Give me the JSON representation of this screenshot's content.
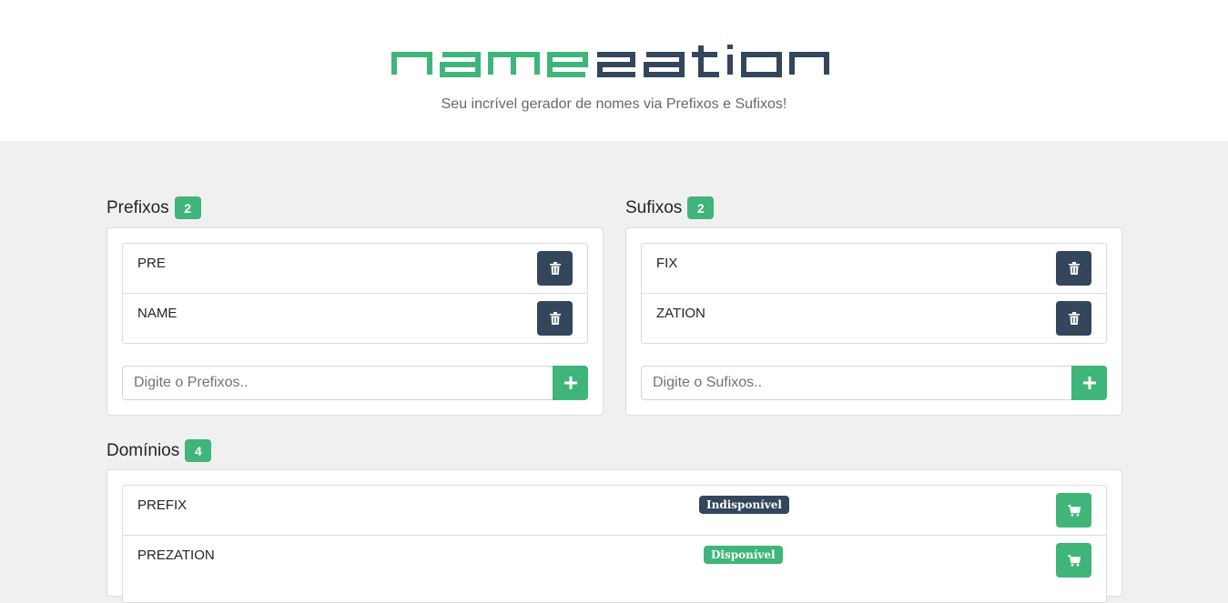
{
  "brand": {
    "logo_text": "namezation",
    "logo_part1": "name",
    "logo_part2": "zation",
    "primary_color": "#3fb57a",
    "dark_color": "#34465c",
    "tagline": "Seu incrível gerador de nomes via Prefixos e Sufixos!"
  },
  "prefixos": {
    "title": "Prefixos",
    "count": "2",
    "items": [
      {
        "label": "PRE",
        "icon": "trash-icon"
      },
      {
        "label": "NAME",
        "icon": "trash-icon"
      }
    ],
    "input_placeholder": "Digite o Prefixos..",
    "add_icon": "plus-icon"
  },
  "sufixos": {
    "title": "Sufixos",
    "count": "2",
    "items": [
      {
        "label": "FIX",
        "icon": "trash-icon"
      },
      {
        "label": "ZATION",
        "icon": "trash-icon"
      }
    ],
    "input_placeholder": "Digite o Sufixos..",
    "add_icon": "plus-icon"
  },
  "dominios": {
    "title": "Domínios",
    "count": "4",
    "items": [
      {
        "label": "PREFIX",
        "status": "Indisponível",
        "available": false,
        "icon": "cart-icon"
      },
      {
        "label": "PREZATION",
        "status": "Disponível",
        "available": true,
        "icon": "cart-icon"
      }
    ]
  }
}
